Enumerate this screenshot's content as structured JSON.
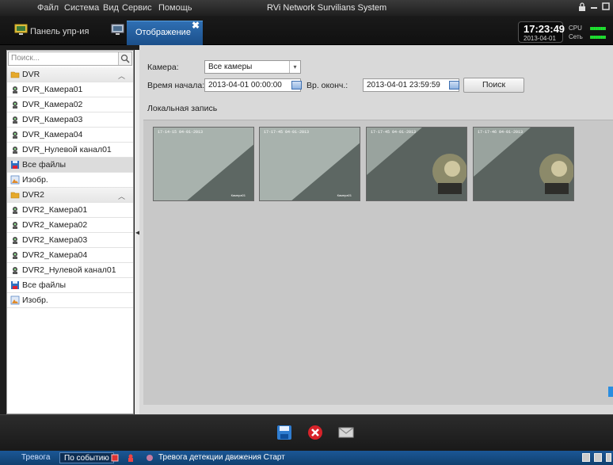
{
  "menubar": {
    "items": [
      "Файл",
      "Система",
      "Вид",
      "Сервис",
      "Помощь"
    ],
    "app_title": "RVi Network Survilians System"
  },
  "tabs": [
    {
      "label": "Панель упр-ия",
      "icon": "monitor-icon"
    },
    {
      "label": "Отображение",
      "icon": "display-icon",
      "close": "✖"
    }
  ],
  "status_widget": {
    "time": "17:23:49",
    "date": "2013-04-01",
    "cpu_label": "CPU",
    "net_label": "Сеть"
  },
  "sidebar": {
    "search_placeholder": "Поиск...",
    "items": [
      {
        "label": "DVR",
        "type": "group",
        "icon": "folder-icon"
      },
      {
        "label": "DVR_Камера01",
        "type": "camera",
        "icon": "camera-icon"
      },
      {
        "label": "DVR_Камера02",
        "type": "camera",
        "icon": "camera-icon"
      },
      {
        "label": "DVR_Камера03",
        "type": "camera",
        "icon": "camera-icon"
      },
      {
        "label": "DVR_Камера04",
        "type": "camera",
        "icon": "camera-icon"
      },
      {
        "label": "DVR_Нулевой канал01",
        "type": "camera",
        "icon": "camera-icon"
      },
      {
        "label": "Все файлы",
        "type": "files",
        "icon": "save-files-icon",
        "selected": true
      },
      {
        "label": "Изобр.",
        "type": "images",
        "icon": "image-icon"
      },
      {
        "label": "DVR2",
        "type": "group",
        "icon": "folder-icon"
      },
      {
        "label": "DVR2_Камера01",
        "type": "camera",
        "icon": "camera-icon"
      },
      {
        "label": "DVR2_Камера02",
        "type": "camera",
        "icon": "camera-icon"
      },
      {
        "label": "DVR2_Камера03",
        "type": "camera",
        "icon": "camera-icon"
      },
      {
        "label": "DVR2_Камера04",
        "type": "camera",
        "icon": "camera-icon"
      },
      {
        "label": "DVR2_Нулевой канал01",
        "type": "camera",
        "icon": "camera-icon"
      },
      {
        "label": "Все файлы",
        "type": "files",
        "icon": "save-files-icon"
      },
      {
        "label": "Изобр.",
        "type": "images",
        "icon": "image-icon"
      }
    ]
  },
  "filter": {
    "camera_label": "Камера:",
    "camera_value": "Все камеры",
    "start_label": "Время начала:",
    "start_value": "2013-04-01 00:00:00",
    "end_label": "Вр. оконч.:",
    "end_value": "2013-04-01 23:59:59",
    "search_button": "Поиск"
  },
  "section_title": "Локальная запись",
  "thumbnails": [
    {
      "stamp": "17-14-15 04-01-2013",
      "camera": "Камера01",
      "variant": "wall"
    },
    {
      "stamp": "17-17-45 04-01-2013",
      "camera": "Камера01",
      "variant": "wall"
    },
    {
      "stamp": "17-17-45 04-01-2013",
      "camera": "",
      "variant": "device"
    },
    {
      "stamp": "17-17-46 04-01-2013",
      "camera": "",
      "variant": "device"
    }
  ],
  "toolbar": {
    "icons": [
      "save-icon",
      "delete-icon",
      "email-icon"
    ]
  },
  "statusbar": {
    "alarm_tab": "Тревога",
    "event_tab": "По событию",
    "message": "Тревога детекции движения Старт"
  },
  "colors": {
    "tab_active": "#2f6fb3",
    "status_bar": "#1b5796",
    "delete_red": "#d8232a"
  }
}
